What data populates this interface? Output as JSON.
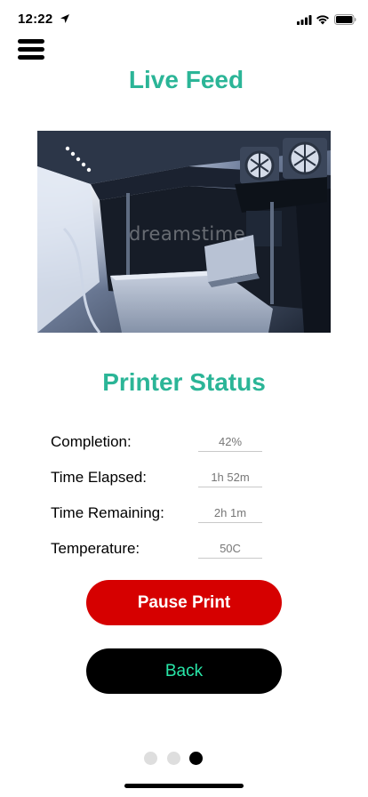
{
  "status_bar": {
    "time": "12:22",
    "icons": [
      "location-arrow-icon",
      "signal-icon",
      "wifi-icon",
      "battery-icon"
    ]
  },
  "header": {
    "menu_icon": "hamburger-menu-icon",
    "title": "Live Feed"
  },
  "live_feed": {
    "watermark": "dreamstime"
  },
  "printer_status": {
    "title": "Printer Status",
    "rows": [
      {
        "label": "Completion:",
        "value": "42%"
      },
      {
        "label": "Time Elapsed:",
        "value": "1h 52m"
      },
      {
        "label": "Time Remaining:",
        "value": "2h 1m"
      },
      {
        "label": "Temperature:",
        "value": "50C"
      }
    ]
  },
  "actions": {
    "pause_label": "Pause Print",
    "back_label": "Back"
  },
  "pagination": {
    "total": 3,
    "active_index": 2
  },
  "colors": {
    "accent": "#2bb597",
    "pause_button": "#d60000",
    "back_button": "#000000",
    "back_text": "#28e6a8"
  }
}
